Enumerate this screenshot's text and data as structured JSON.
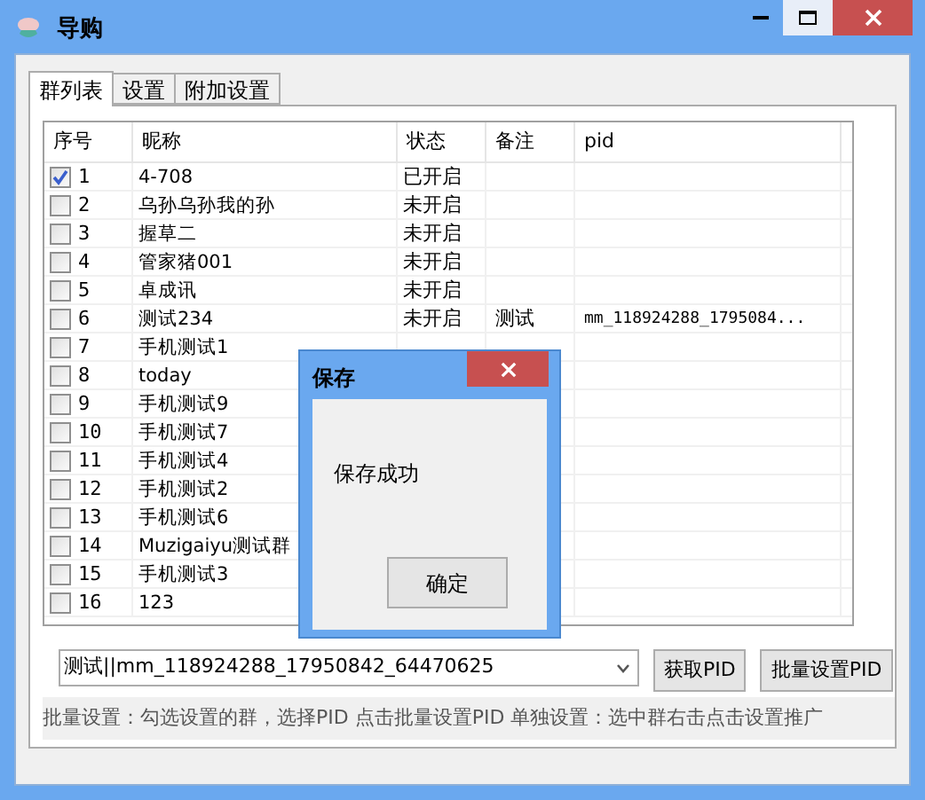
{
  "window": {
    "title": "导购"
  },
  "tabs": [
    {
      "label": "群列表",
      "selected": true
    },
    {
      "label": "设置",
      "selected": false
    },
    {
      "label": "附加设置",
      "selected": false
    }
  ],
  "table": {
    "columns": [
      "序号",
      "昵称",
      "状态",
      "备注",
      "pid"
    ],
    "rows": [
      {
        "number": "1",
        "name": "4-708",
        "status": "已开启",
        "checked": true
      },
      {
        "number": "2",
        "name": "乌孙乌孙我的孙",
        "status": "未开启",
        "checked": false
      },
      {
        "number": "3",
        "name": "握草二",
        "status": "未开启",
        "checked": false
      },
      {
        "number": "4",
        "name": "管家猪001",
        "status": "未开启",
        "checked": false
      },
      {
        "number": "5",
        "name": "卓成讯",
        "status": "未开启",
        "checked": false
      },
      {
        "number": "6",
        "name": "测试234",
        "status": "未开启",
        "note": "测试",
        "pid": "mm_118924288_1795084...",
        "checked": false
      },
      {
        "number": "7",
        "name": "手机测试1",
        "checked": false
      },
      {
        "number": "8",
        "name": "today",
        "checked": false
      },
      {
        "number": "9",
        "name": "手机测试9",
        "checked": false
      },
      {
        "number": "10",
        "name": "手机测试7",
        "checked": false
      },
      {
        "number": "11",
        "name": "手机测试4",
        "checked": false
      },
      {
        "number": "12",
        "name": "手机测试2",
        "checked": false
      },
      {
        "number": "13",
        "name": "手机测试6",
        "checked": false
      },
      {
        "number": "14",
        "name": "Muzigaiyu测试群",
        "checked": false
      },
      {
        "number": "15",
        "name": "手机测试3",
        "checked": false
      },
      {
        "number": "16",
        "name": "123",
        "checked": false
      }
    ]
  },
  "pid_select": {
    "value": "测试||mm_118924288_17950842_64470625"
  },
  "buttons": [
    "获取PID",
    "批量设置PID"
  ],
  "hint": "批量设置：勾选设置的群，选择PID 点击批量设置PID 单独设置：选中群右击点击设置推广",
  "dialog": {
    "title": "保存",
    "message": "保存成功",
    "button": "确定"
  }
}
